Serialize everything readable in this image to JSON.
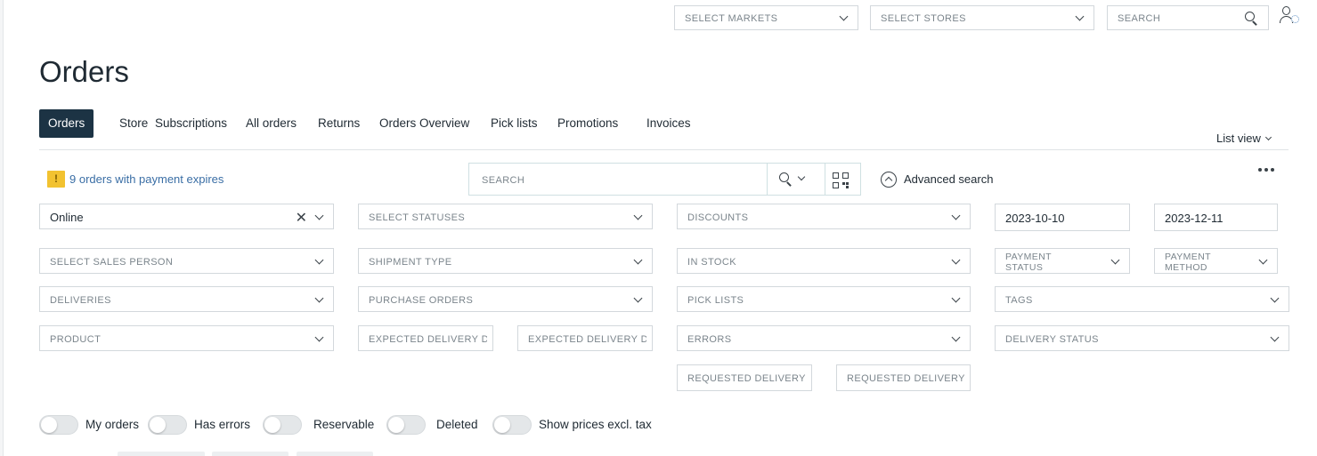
{
  "topbar": {
    "markets_placeholder": "SELECT MARKETS",
    "stores_placeholder": "SELECT STORES",
    "search_placeholder": "SEARCH"
  },
  "page_title": "Orders",
  "tabs": [
    {
      "label": "Orders",
      "active": true
    },
    {
      "label": "Store"
    },
    {
      "label": "Subscriptions"
    },
    {
      "label": "All orders"
    },
    {
      "label": "Returns"
    },
    {
      "label": "Orders Overview"
    },
    {
      "label": "Pick lists"
    },
    {
      "label": "Promotions"
    },
    {
      "label": "Invoices"
    }
  ],
  "list_view_label": "List view",
  "warning": {
    "badge": "!",
    "text": "9 orders with payment expires"
  },
  "order_search": {
    "placeholder": "SEARCH"
  },
  "advanced_search_label": "Advanced search",
  "filters": {
    "channel_value": "Online",
    "statuses": "SELECT STATUSES",
    "discounts": "DISCOUNTS",
    "date_from": "2023-10-10",
    "date_to": "2023-12-11",
    "sales_person": "SELECT SALES PERSON",
    "shipment_type": "SHIPMENT TYPE",
    "in_stock": "IN STOCK",
    "payment_status": "PAYMENT STATUS",
    "payment_method": "PAYMENT METHOD",
    "deliveries": "DELIVERIES",
    "purchase_orders": "PURCHASE ORDERS",
    "pick_lists": "PICK LISTS",
    "tags": "TAGS",
    "product": "PRODUCT",
    "expected_delivery_from": "EXPECTED DELIVERY DAT",
    "expected_delivery_to": "EXPECTED DELIVERY DAT",
    "errors": "ERRORS",
    "delivery_status": "DELIVERY STATUS",
    "requested_delivery_from": "REQUESTED DELIVERY FR",
    "requested_delivery_to": "REQUESTED DELIVERY TO"
  },
  "toggles": [
    {
      "label": "My orders",
      "on": false
    },
    {
      "label": "Has errors",
      "on": false
    },
    {
      "label": "Reservable",
      "on": false
    },
    {
      "label": "Deleted",
      "on": false
    },
    {
      "label": "Show prices excl. tax",
      "on": false
    }
  ],
  "colors": {
    "active_tab": "#1c3344",
    "warning": "#f2c230",
    "link": "#3a6ea5"
  },
  "icons": [
    "chevron-down-icon",
    "search-icon",
    "user-settings-icon",
    "qr-code-icon",
    "chevron-up-circle-icon",
    "more-icon",
    "close-icon",
    "warning-icon"
  ]
}
